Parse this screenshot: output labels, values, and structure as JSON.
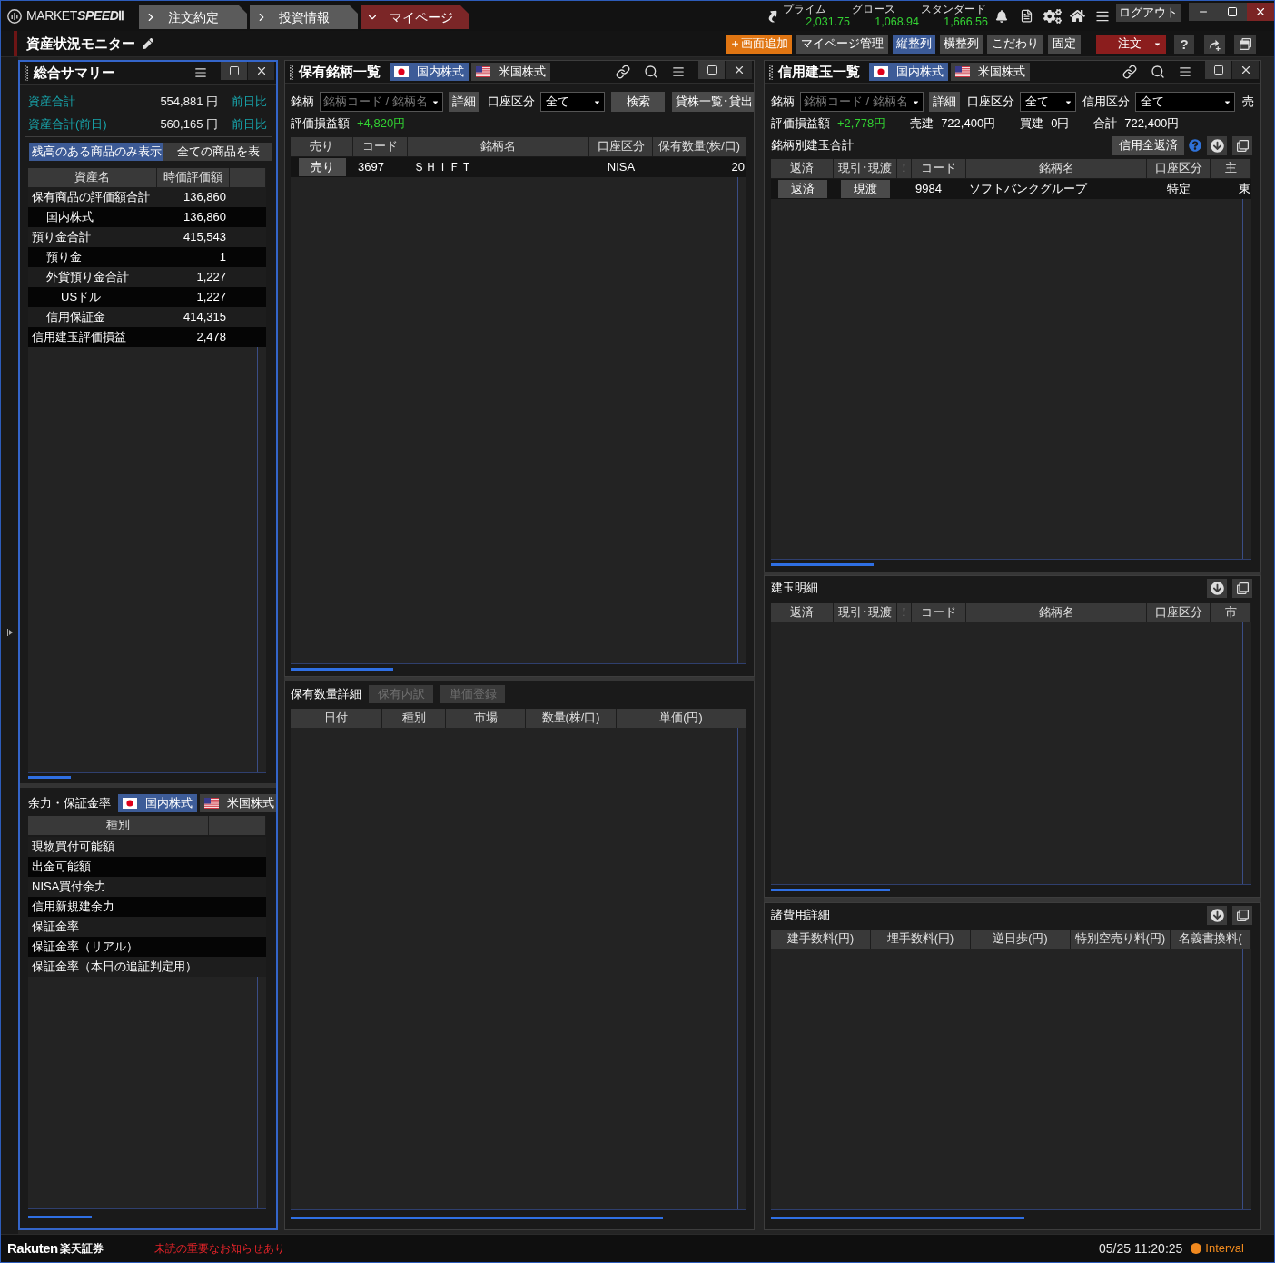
{
  "app": {
    "logo": {
      "prefix": "MARKET",
      "emphasis": "SPEED",
      "suffix": "Ⅱ"
    },
    "nav_tabs": [
      {
        "label": "注文約定",
        "selected": false
      },
      {
        "label": "投資情報",
        "selected": false
      },
      {
        "label": "マイページ",
        "selected": true
      }
    ],
    "indices": [
      {
        "name": "プライム",
        "value": "2,031.75"
      },
      {
        "name": "グロース",
        "value": "1,068.94"
      },
      {
        "name": "スタンダード",
        "value": "1,666.56"
      }
    ],
    "logout_button": "ログアウト"
  },
  "page": {
    "title": "資産状況モニター",
    "toolbar": [
      {
        "kind": "add",
        "label": "＋画面追加"
      },
      {
        "kind": "normal",
        "label": "マイページ管理"
      },
      {
        "kind": "arrange",
        "label": "縦整列",
        "selected": true
      },
      {
        "kind": "arrange",
        "label": "横整列",
        "selected": false
      },
      {
        "kind": "normal",
        "label": "こだわり"
      },
      {
        "kind": "normal",
        "label": "固定"
      }
    ],
    "order_button": "注文",
    "help_button": "?"
  },
  "summary": {
    "title": "総合サマリー",
    "totals": [
      {
        "label": "資産合計",
        "value": "554,881 円",
        "compare": "前日比"
      },
      {
        "label": "資産合計(前日)",
        "value": "560,165 円",
        "compare": "前日比"
      }
    ],
    "filters": [
      {
        "label": "残高のある商品のみ表示",
        "selected": true
      },
      {
        "label": "全ての商品を表",
        "selected": false
      }
    ],
    "columns": [
      "資産名",
      "時価評価額"
    ],
    "rows": [
      {
        "name": "保有商品の評価額合計",
        "value": "136,860",
        "children": [
          {
            "name": "国内株式",
            "value": "136,860"
          }
        ]
      },
      {
        "name": "預り金合計",
        "value": "415,543",
        "children": [
          {
            "name": "預り金",
            "value": "1"
          },
          {
            "name": "外貨預り金合計",
            "value": "1,227",
            "children": [
              {
                "name": "USドル",
                "value": "1,227"
              }
            ]
          },
          {
            "name": "信用保証金",
            "value": "414,315"
          }
        ]
      },
      {
        "name": "信用建玉評価損益",
        "value": "2,478"
      }
    ]
  },
  "margin_power": {
    "title": "余力・保証金率",
    "markets": [
      {
        "kind": "jp",
        "label": "国内株式",
        "selected": true
      },
      {
        "kind": "us",
        "label": "米国株式",
        "selected": false
      }
    ],
    "columns": [
      "種別"
    ],
    "rows": [
      "現物買付可能額",
      "出金可能額",
      "NISA買付余力",
      "信用新規建余力",
      "保証金率",
      "保証金率（リアル）",
      "保証金率（本日の追証判定用）"
    ]
  },
  "holdings": {
    "title": "保有銘柄一覧",
    "markets": [
      {
        "kind": "jp",
        "label": "国内株式",
        "selected": true
      },
      {
        "kind": "us",
        "label": "米国株式",
        "selected": false
      }
    ],
    "filter": {
      "symbol_label": "銘柄",
      "symbol_placeholder": "銘柄コード / 銘柄名",
      "detail_button": "詳細",
      "account_label": "口座区分",
      "account_value": "全て",
      "search_button": "検索",
      "lending_button": "貸株一覧･貸出"
    },
    "pnl": [
      {
        "label": "評価損益額",
        "value": "+4,820円",
        "kind": "gain"
      }
    ],
    "columns": [
      "売り",
      "コード",
      "銘柄名",
      "口座区分",
      "保有数量(株/口)"
    ],
    "rows": [
      {
        "action": "売り",
        "code": "3697",
        "name": "ＳＨＩＦＴ",
        "account": "NISA",
        "quantity": "20"
      }
    ]
  },
  "quantity_detail": {
    "title": "保有数量詳細",
    "buttons": [
      {
        "label": "保有内訳",
        "disabled": true
      },
      {
        "label": "単価登録",
        "disabled": true
      }
    ],
    "columns": [
      "日付",
      "種別",
      "市場",
      "数量(株/口)",
      "単価(円)"
    ]
  },
  "margin_positions": {
    "title": "信用建玉一覧",
    "markets": [
      {
        "kind": "jp",
        "label": "国内株式",
        "selected": true
      },
      {
        "kind": "us",
        "label": "米国株式",
        "selected": false
      }
    ],
    "filter": {
      "symbol_label": "銘柄",
      "symbol_placeholder": "銘柄コード / 銘柄名",
      "detail_button": "詳細",
      "account_label": "口座区分",
      "account_value": "全て",
      "margin_label": "信用区分",
      "margin_value": "全て",
      "trade_label": "売"
    },
    "pnl": [
      {
        "label": "評価損益額",
        "value": "+2,778円",
        "kind": "gain"
      },
      {
        "label": "売建",
        "value": "722,400円",
        "kind": "plain"
      },
      {
        "label": "買建",
        "value": "0円",
        "kind": "plain"
      },
      {
        "label": "合計",
        "value": "722,400円",
        "kind": "plain"
      }
    ],
    "group_label": "銘柄別建玉合計",
    "close_all_button": "信用全返済",
    "columns": [
      "返済",
      "現引･現渡",
      "!",
      "コード",
      "銘柄名",
      "口座区分",
      "主"
    ],
    "rows": [
      {
        "repay": "返済",
        "delivery": "現渡",
        "code": "9984",
        "name": "ソフトバンクグループ",
        "account": "特定",
        "market": "東"
      }
    ]
  },
  "position_detail": {
    "title": "建玉明細",
    "columns": [
      "返済",
      "現引･現渡",
      "!",
      "コード",
      "銘柄名",
      "口座区分",
      "市"
    ]
  },
  "fees": {
    "title": "諸費用詳細",
    "columns": [
      "建手数料(円)",
      "埋手数料(円)",
      "逆日歩(円)",
      "特別空売り料(円)",
      "名義書換料("
    ]
  },
  "status_bar": {
    "brand": "Rakuten",
    "brand_name": "楽天証券",
    "notice": "未読の重要なお知らせあり",
    "time": "05/25 11:20:25",
    "status": "Interval"
  }
}
